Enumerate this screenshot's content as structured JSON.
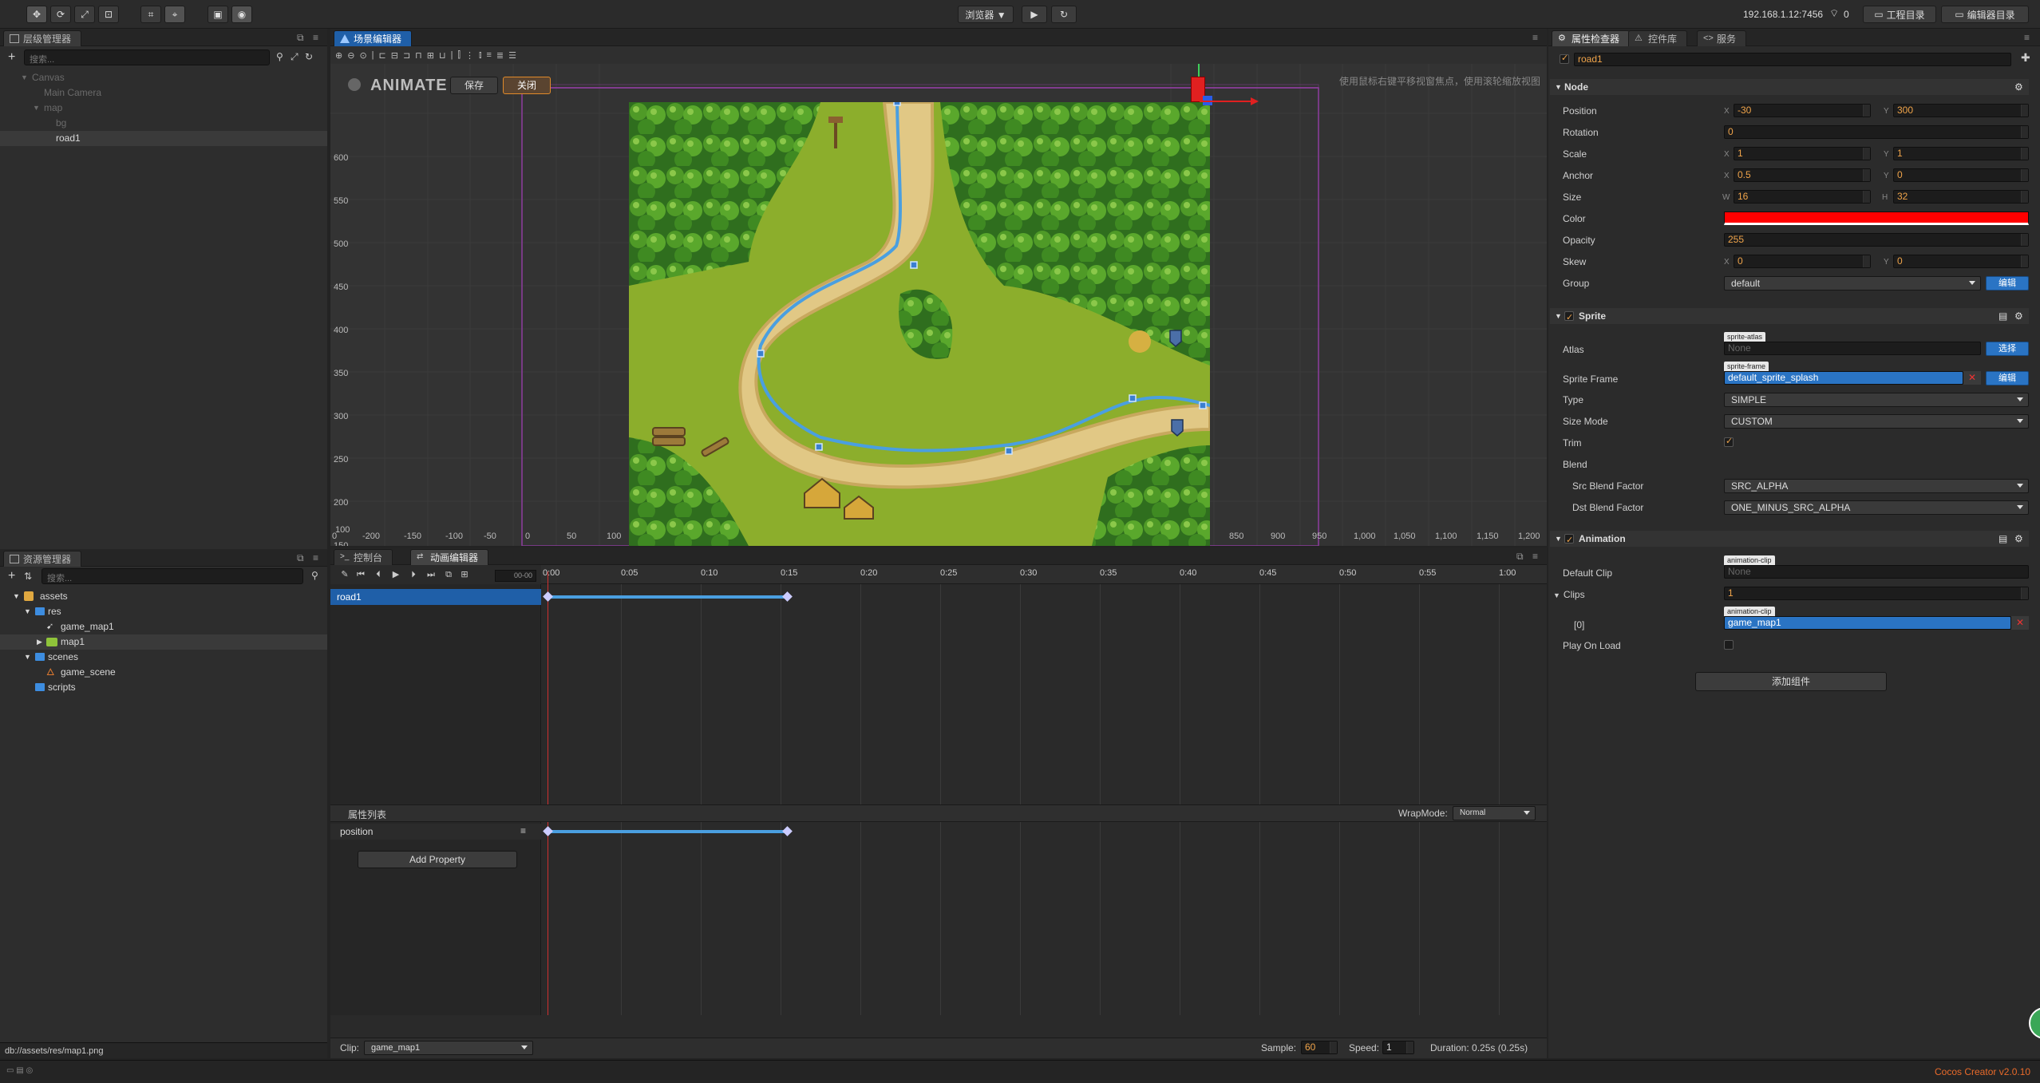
{
  "topbar": {
    "preview_label": "浏览器 ▼",
    "ip_address": "192.168.1.12:7456",
    "connections": "0",
    "project_dir_label": "工程目录",
    "editor_dir_label": "编辑器目录"
  },
  "hierarchy": {
    "tab_label": "层级管理器",
    "search_placeholder": "搜索...",
    "items": [
      {
        "label": "Canvas",
        "dim": true
      },
      {
        "label": "Main Camera",
        "dim": true
      },
      {
        "label": "map",
        "dim": true
      },
      {
        "label": "bg",
        "dim": true
      },
      {
        "label": "road1",
        "dim": false
      }
    ]
  },
  "assets": {
    "tab_label": "资源管理器",
    "search_placeholder": "搜索...",
    "items": [
      {
        "label": "assets"
      },
      {
        "label": "res"
      },
      {
        "label": "game_map1"
      },
      {
        "label": "map1"
      },
      {
        "label": "scenes"
      },
      {
        "label": "game_scene"
      },
      {
        "label": "scripts"
      }
    ],
    "status_path": "db://assets/res/map1.png"
  },
  "scene": {
    "tab_label": "场景编辑器",
    "animate_label": "ANIMATE",
    "save_label": "保存",
    "close_label": "关闭",
    "hint": "使用鼠标右键平移视窗焦点，使用滚轮缩放视图",
    "y_ticks": [
      "600",
      "550",
      "500",
      "450",
      "400",
      "350",
      "300",
      "250",
      "200",
      "150",
      "100"
    ],
    "x_ticks": [
      "0",
      "-200",
      "-150",
      "-100",
      "-50",
      "0",
      "50",
      "100",
      "850",
      "900",
      "950",
      "1,000",
      "1,050",
      "1,100",
      "1,150",
      "1,200"
    ]
  },
  "timeline": {
    "console_tab": "控制台",
    "anim_tab": "动画编辑器",
    "time_field": "00-00",
    "ticks": [
      "0:00",
      "0:05",
      "0:10",
      "0:15",
      "0:20",
      "0:25",
      "0:30",
      "0:35",
      "0:40",
      "0:45",
      "0:50",
      "0:55",
      "1:00"
    ],
    "node_name": "road1",
    "property_list_label": "属性列表",
    "wrapmode_label": "WrapMode:",
    "wrapmode_value": "Normal",
    "property_name": "position",
    "add_property_label": "Add Property",
    "clip_label": "Clip:",
    "clip_value": "game_map1",
    "sample_label": "Sample:",
    "sample_value": "60",
    "speed_label": "Speed:",
    "speed_value": "1",
    "duration": "Duration: 0.25s (0.25s)"
  },
  "inspector": {
    "tabs": [
      "属性检查器",
      "控件库",
      "服务"
    ],
    "node_name": "road1",
    "node_section": "Node",
    "position_label": "Position",
    "position_x": "-30",
    "position_y": "300",
    "rotation_label": "Rotation",
    "rotation": "0",
    "scale_label": "Scale",
    "scale_x": "1",
    "scale_y": "1",
    "anchor_label": "Anchor",
    "anchor_x": "0.5",
    "anchor_y": "0",
    "size_label": "Size",
    "size_w": "16",
    "size_h": "32",
    "color_label": "Color",
    "color_value": "#ff0000",
    "opacity_label": "Opacity",
    "opacity": "255",
    "skew_label": "Skew",
    "skew_x": "0",
    "skew_y": "0",
    "group_label": "Group",
    "group_value": "default",
    "group_edit": "编辑",
    "sprite_section": "Sprite",
    "atlas_label": "Atlas",
    "atlas_badge": "sprite-atlas",
    "atlas_value": "None",
    "atlas_btn": "选择",
    "sprite_frame_label": "Sprite Frame",
    "sprite_frame_badge": "sprite-frame",
    "sprite_frame_value": "default_sprite_splash",
    "sprite_frame_btn": "编辑",
    "type_label": "Type",
    "type_value": "SIMPLE",
    "size_mode_label": "Size Mode",
    "size_mode_value": "CUSTOM",
    "trim_label": "Trim",
    "blend_label": "Blend",
    "src_blend_label": "Src Blend Factor",
    "src_blend_value": "SRC_ALPHA",
    "dst_blend_label": "Dst Blend Factor",
    "dst_blend_value": "ONE_MINUS_SRC_ALPHA",
    "animation_section": "Animation",
    "default_clip_label": "Default Clip",
    "default_clip_badge": "animation-clip",
    "default_clip_value": "None",
    "clips_label": "Clips",
    "clips_count": "1",
    "clip0_label": "[0]",
    "clip0_badge": "animation-clip",
    "clip0_value": "game_map1",
    "play_on_load_label": "Play On Load",
    "add_component_label": "添加组件"
  },
  "footer": {
    "version": "Cocos Creator v2.0.10"
  },
  "colors": {
    "accent": "#2a74c4",
    "orange": "#f0a44a",
    "path": "#4a9fe0"
  }
}
